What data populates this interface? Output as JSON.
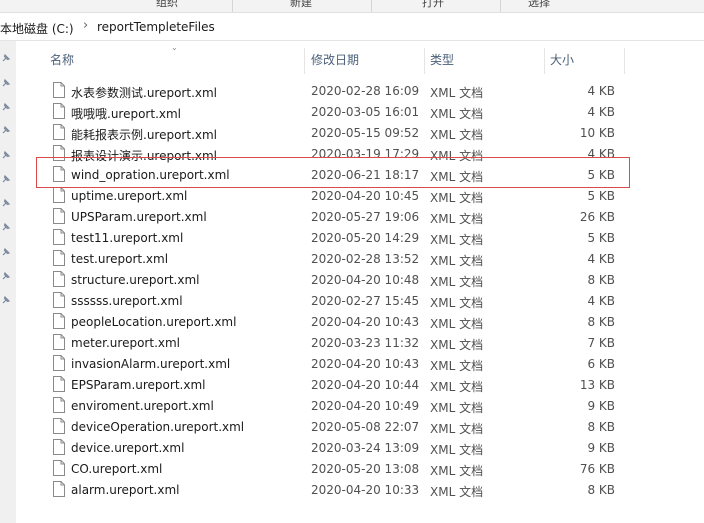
{
  "ribbon": {
    "labels": [
      "组织",
      "新建",
      "打开",
      "选择"
    ]
  },
  "address": {
    "drive": "本地磁盘 (C:)",
    "folder": "reportTempleteFiles"
  },
  "columns": {
    "name": "名称",
    "date": "修改日期",
    "type": "类型",
    "size": "大小"
  },
  "files": [
    {
      "name": "水表参数测试.ureport.xml",
      "date": "2020-02-28 16:09",
      "type": "XML 文档",
      "size": "4 KB"
    },
    {
      "name": "哦哦哦.ureport.xml",
      "date": "2020-03-05 16:01",
      "type": "XML 文档",
      "size": "4 KB"
    },
    {
      "name": "能耗报表示例.ureport.xml",
      "date": "2020-05-15 09:52",
      "type": "XML 文档",
      "size": "10 KB"
    },
    {
      "name": "报表设计演示.ureport.xml",
      "date": "2020-03-19 17:29",
      "type": "XML 文档",
      "size": "4 KB"
    },
    {
      "name": "wind_opration.ureport.xml",
      "date": "2020-06-21 18:17",
      "type": "XML 文档",
      "size": "5 KB"
    },
    {
      "name": "uptime.ureport.xml",
      "date": "2020-04-20 10:45",
      "type": "XML 文档",
      "size": "5 KB"
    },
    {
      "name": "UPSParam.ureport.xml",
      "date": "2020-05-27 19:06",
      "type": "XML 文档",
      "size": "26 KB"
    },
    {
      "name": "test11.ureport.xml",
      "date": "2020-05-20 14:29",
      "type": "XML 文档",
      "size": "5 KB"
    },
    {
      "name": "test.ureport.xml",
      "date": "2020-02-28 13:52",
      "type": "XML 文档",
      "size": "4 KB"
    },
    {
      "name": "structure.ureport.xml",
      "date": "2020-04-20 10:48",
      "type": "XML 文档",
      "size": "8 KB"
    },
    {
      "name": "ssssss.ureport.xml",
      "date": "2020-02-27 15:45",
      "type": "XML 文档",
      "size": "4 KB"
    },
    {
      "name": "peopleLocation.ureport.xml",
      "date": "2020-04-20 10:43",
      "type": "XML 文档",
      "size": "8 KB"
    },
    {
      "name": "meter.ureport.xml",
      "date": "2020-03-23 11:32",
      "type": "XML 文档",
      "size": "7 KB"
    },
    {
      "name": "invasionAlarm.ureport.xml",
      "date": "2020-04-20 10:43",
      "type": "XML 文档",
      "size": "6 KB"
    },
    {
      "name": "EPSParam.ureport.xml",
      "date": "2020-04-20 10:44",
      "type": "XML 文档",
      "size": "13 KB"
    },
    {
      "name": "enviroment.ureport.xml",
      "date": "2020-04-20 10:49",
      "type": "XML 文档",
      "size": "9 KB"
    },
    {
      "name": "deviceOperation.ureport.xml",
      "date": "2020-05-08 22:07",
      "type": "XML 文档",
      "size": "8 KB"
    },
    {
      "name": "device.ureport.xml",
      "date": "2020-03-24 13:09",
      "type": "XML 文档",
      "size": "9 KB"
    },
    {
      "name": "CO.ureport.xml",
      "date": "2020-05-20 13:08",
      "type": "XML 文档",
      "size": "76 KB"
    },
    {
      "name": "alarm.ureport.xml",
      "date": "2020-04-20 10:33",
      "type": "XML 文档",
      "size": "8 KB"
    }
  ],
  "highlight": {
    "color": "#d94a4a",
    "row_name": "wind_opration.ureport.xml"
  }
}
